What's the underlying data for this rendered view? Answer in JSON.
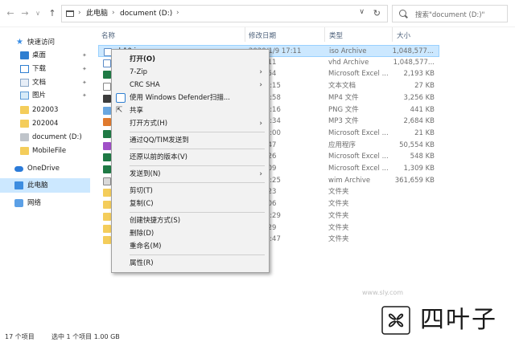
{
  "address_bar": {
    "crumbs": [
      "此电脑",
      "document (D:)"
    ],
    "search_placeholder": "搜索\"document (D:)\""
  },
  "sidebar": {
    "items": [
      {
        "label": "快速访问",
        "icon": "star-icon"
      },
      {
        "label": "桌面",
        "icon": "desktop-icon",
        "pinned": true
      },
      {
        "label": "下载",
        "icon": "download-icon",
        "pinned": true
      },
      {
        "label": "文档",
        "icon": "documents-icon",
        "pinned": true
      },
      {
        "label": "图片",
        "icon": "pictures-icon",
        "pinned": true
      },
      {
        "label": "202003",
        "icon": "folder-icon"
      },
      {
        "label": "202004",
        "icon": "folder-icon"
      },
      {
        "label": "document (D:)",
        "icon": "drive-icon"
      },
      {
        "label": "MobileFile",
        "icon": "folder-icon"
      },
      {
        "label": "OneDrive",
        "icon": "onedrive-icon"
      },
      {
        "label": "此电脑",
        "icon": "this-pc-icon",
        "selected": true
      },
      {
        "label": "网络",
        "icon": "network-icon"
      }
    ]
  },
  "file_list": {
    "columns": {
      "name": "名称",
      "date": "修改日期",
      "type": "类型",
      "size": "大小"
    },
    "rows": [
      {
        "name": "ch10.i",
        "date": "2020/1/9 17:11",
        "type": "iso Archive",
        "size": "1,048,577...",
        "icon": "iso",
        "selected": true
      },
      {
        "name": "",
        "date": "/9 17:11",
        "type": "vhd Archive",
        "size": "1,048,577...",
        "icon": "iso"
      },
      {
        "name": "",
        "date": "/8 22:54",
        "type": "Microsoft Excel ...",
        "size": "2,193 KB",
        "icon": "xls"
      },
      {
        "name": "",
        "date": "/10 17:15",
        "type": "文本文档",
        "size": "27 KB",
        "icon": "txt"
      },
      {
        "name": "",
        "date": "/19 21:58",
        "type": "MP4 文件",
        "size": "3,256 KB",
        "icon": "mp4"
      },
      {
        "name": "",
        "date": "/31 12:16",
        "type": "PNG 文件",
        "size": "441 KB",
        "icon": "png"
      },
      {
        "name": "",
        "date": "/28 15:34",
        "type": "MP3 文件",
        "size": "2,684 KB",
        "icon": "mp3"
      },
      {
        "name": "",
        "date": "/14 12:00",
        "type": "Microsoft Excel ...",
        "size": "21 KB",
        "icon": "xls"
      },
      {
        "name": "",
        "date": "/3 21:47",
        "type": "应用程序",
        "size": "50,554 KB",
        "icon": "exe"
      },
      {
        "name": "",
        "date": "/3 21:26",
        "type": "Microsoft Excel ...",
        "size": "548 KB",
        "icon": "xls"
      },
      {
        "name": "",
        "date": "/3 15:09",
        "type": "Microsoft Excel ...",
        "size": "1,309 KB",
        "icon": "xls"
      },
      {
        "name": "",
        "date": "/27 22:25",
        "type": "wim Archive",
        "size": "361,659 KB",
        "icon": "wim"
      },
      {
        "name": "",
        "date": "/7 16:23",
        "type": "文件夹",
        "size": "",
        "icon": "folder"
      },
      {
        "name": "",
        "date": "/7 16:06",
        "type": "文件夹",
        "size": "",
        "icon": "folder"
      },
      {
        "name": "",
        "date": "/19 15:29",
        "type": "文件夹",
        "size": "",
        "icon": "folder"
      },
      {
        "name": "",
        "date": "/7 22:29",
        "type": "文件夹",
        "size": "",
        "icon": "folder"
      },
      {
        "name": "",
        "date": "/18 21:47",
        "type": "文件夹",
        "size": "",
        "icon": "folder"
      }
    ]
  },
  "context_menu": {
    "items": [
      {
        "label": "打开(O)",
        "bold": true
      },
      {
        "label": "7-Zip",
        "submenu": true
      },
      {
        "label": "CRC SHA",
        "submenu": true
      },
      {
        "label": "使用 Windows Defender扫描...",
        "icon": "shield-icon"
      },
      {
        "label": "共享",
        "icon": "share-icon"
      },
      {
        "label": "打开方式(H)",
        "submenu": true
      },
      {
        "separator": true
      },
      {
        "label": "通过QQ/TIM发送到"
      },
      {
        "separator": true
      },
      {
        "label": "还原以前的版本(V)"
      },
      {
        "separator": true
      },
      {
        "label": "发送到(N)",
        "submenu": true
      },
      {
        "separator": true
      },
      {
        "label": "剪切(T)"
      },
      {
        "label": "复制(C)"
      },
      {
        "separator": true
      },
      {
        "label": "创建快捷方式(S)"
      },
      {
        "label": "删除(D)"
      },
      {
        "label": "重命名(M)"
      },
      {
        "separator": true
      },
      {
        "label": "属性(R)"
      }
    ]
  },
  "status_bar": {
    "item_count": "17 个项目",
    "selection": "选中 1 个项目 1.00 GB"
  },
  "watermark": {
    "brand": "四叶子",
    "faint_text": "www.sly.com"
  }
}
